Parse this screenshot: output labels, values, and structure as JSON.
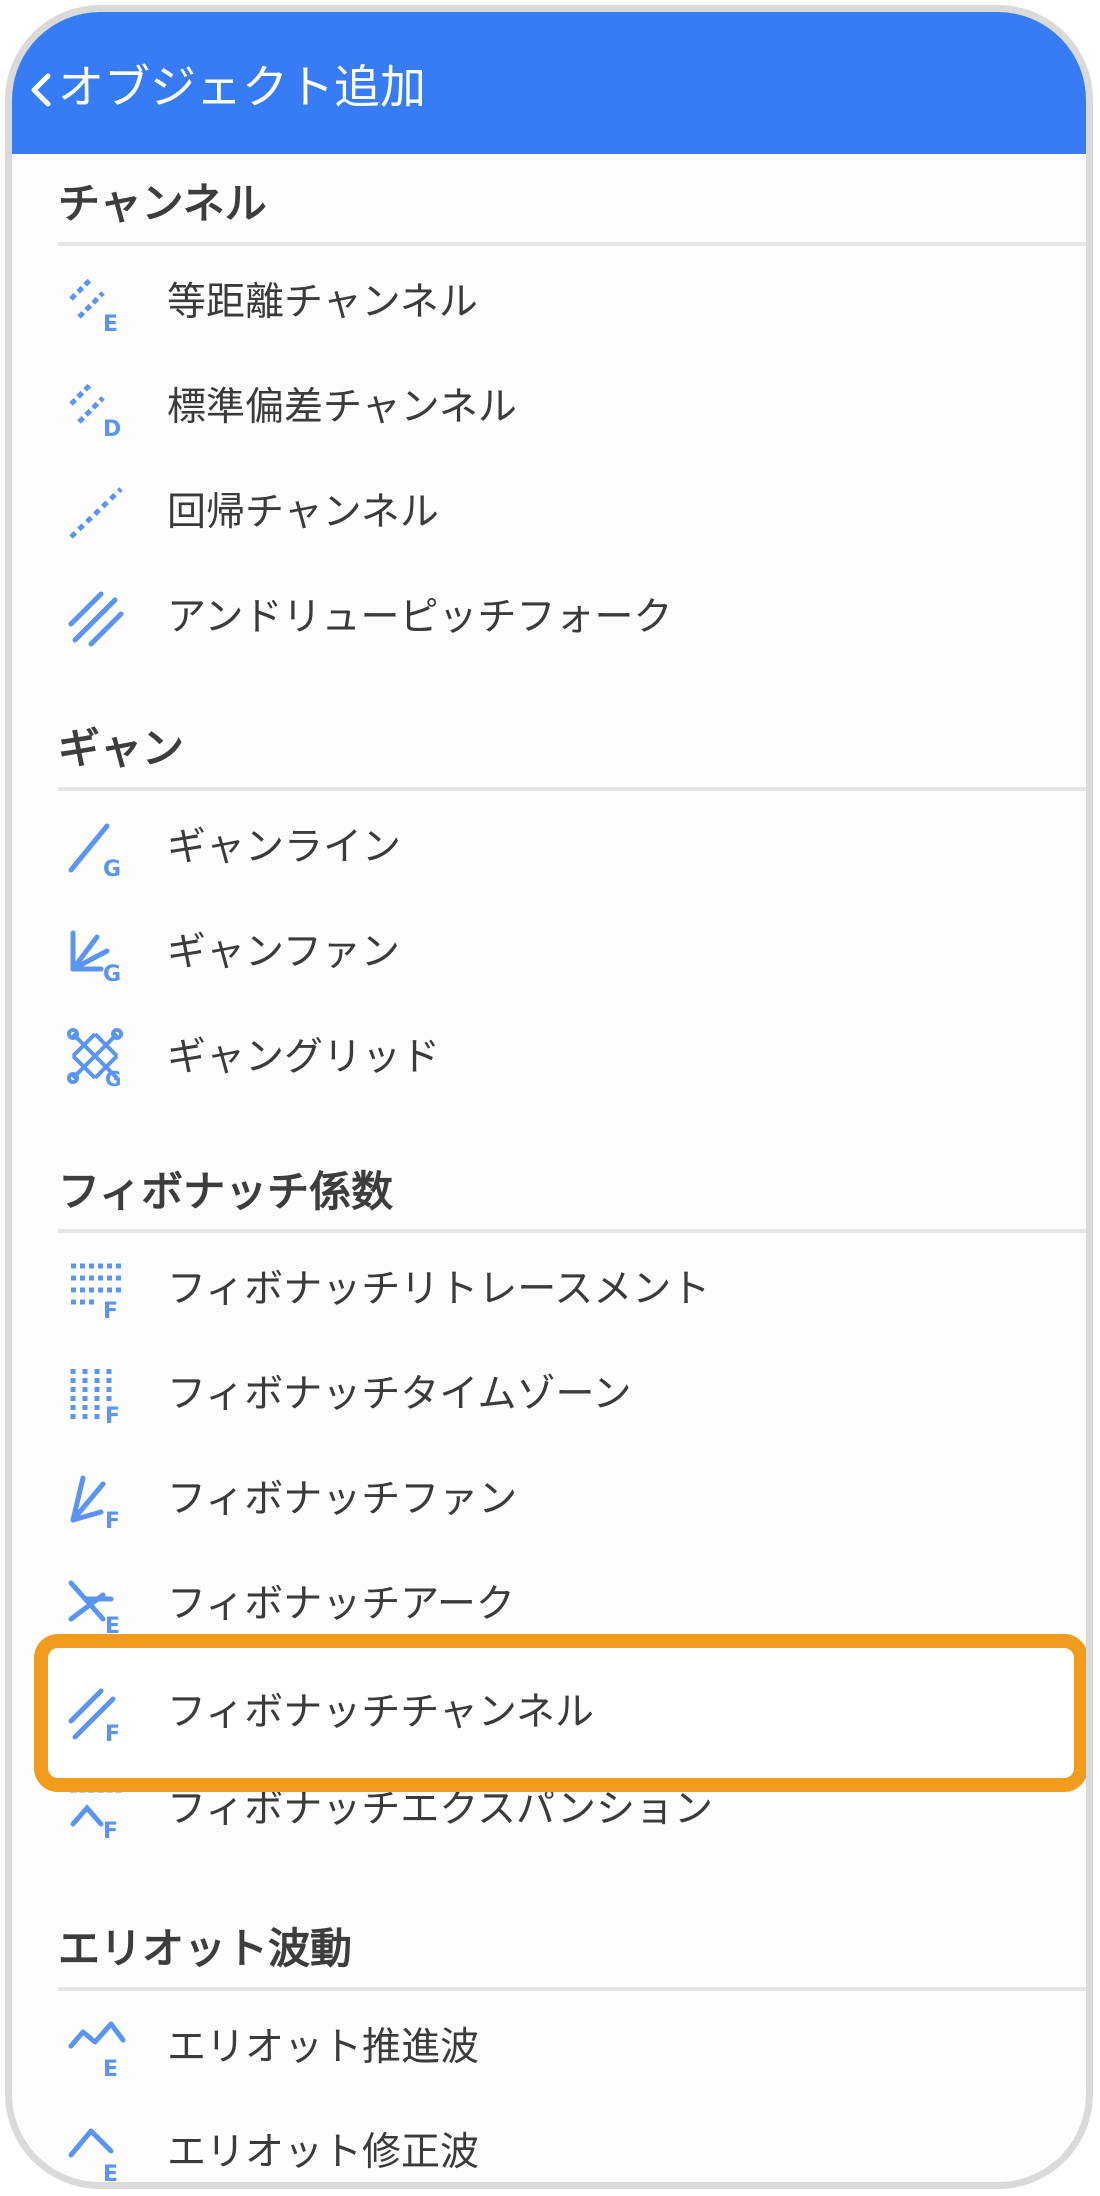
{
  "header": {
    "title": "オブジェクト追加",
    "back_icon": "chevron-left-icon"
  },
  "colors": {
    "header": "#377cf5",
    "icon": "#5b95f3",
    "highlight": "#f29c1e",
    "text": "#3b3b3b"
  },
  "sections": {
    "channel": {
      "title": "チャンネル",
      "items": [
        {
          "label": "等距離チャンネル",
          "icon": "equidistant-channel-icon"
        },
        {
          "label": "標準偏差チャンネル",
          "icon": "std-deviation-channel-icon"
        },
        {
          "label": "回帰チャンネル",
          "icon": "regression-channel-icon"
        },
        {
          "label": "アンドリューピッチフォーク",
          "icon": "andrews-pitchfork-icon"
        }
      ]
    },
    "gann": {
      "title": "ギャン",
      "items": [
        {
          "label": "ギャンライン",
          "icon": "gann-line-icon"
        },
        {
          "label": "ギャンファン",
          "icon": "gann-fan-icon"
        },
        {
          "label": "ギャングリッド",
          "icon": "gann-grid-icon"
        }
      ]
    },
    "fibonacci": {
      "title": "フィボナッチ係数",
      "items": [
        {
          "label": "フィボナッチリトレースメント",
          "icon": "fib-retracement-icon"
        },
        {
          "label": "フィボナッチタイムゾーン",
          "icon": "fib-timezone-icon"
        },
        {
          "label": "フィボナッチファン",
          "icon": "fib-fan-icon"
        },
        {
          "label": "フィボナッチアーク",
          "icon": "fib-arc-icon"
        },
        {
          "label": "フィボナッチチャンネル",
          "icon": "fib-channel-icon",
          "highlighted": true
        },
        {
          "label": "フィボナッチエクスパンション",
          "icon": "fib-expansion-icon"
        }
      ]
    },
    "elliott": {
      "title": "エリオット波動",
      "items": [
        {
          "label": "エリオット推進波",
          "icon": "elliott-impulse-icon"
        },
        {
          "label": "エリオット修正波",
          "icon": "elliott-correction-icon"
        }
      ]
    }
  }
}
